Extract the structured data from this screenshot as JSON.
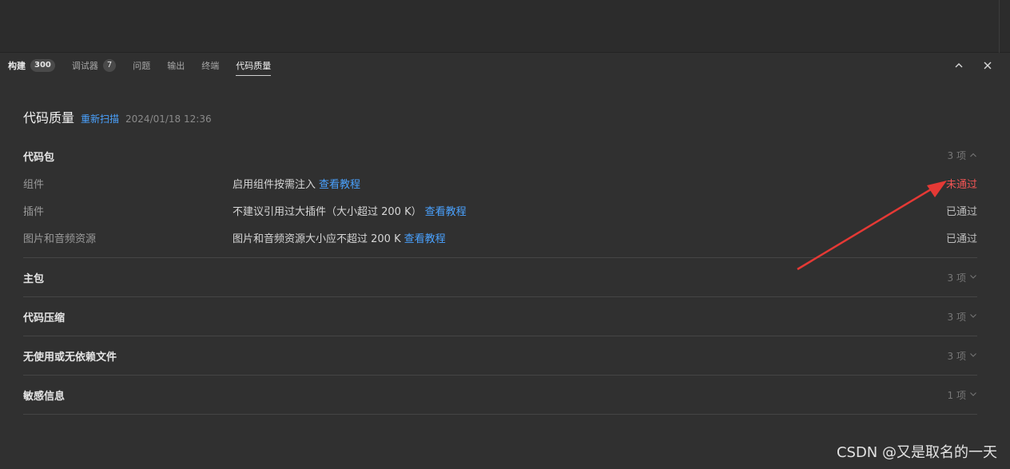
{
  "tabs": [
    {
      "label": "构建",
      "badge": "300",
      "active": false,
      "bold": true
    },
    {
      "label": "调试器",
      "badge": "7",
      "active": false,
      "bold": false
    },
    {
      "label": "问题",
      "badge": null,
      "active": false,
      "bold": false
    },
    {
      "label": "输出",
      "badge": null,
      "active": false,
      "bold": false
    },
    {
      "label": "终端",
      "badge": null,
      "active": false,
      "bold": false
    },
    {
      "label": "代码质量",
      "badge": null,
      "active": true,
      "bold": false
    }
  ],
  "heading": {
    "title": "代码质量",
    "rescan": "重新扫描",
    "time": "2024/01/18 12:36"
  },
  "sections": [
    {
      "title": "代码包",
      "count": "3 项",
      "expanded": true,
      "rows": [
        {
          "name": "组件",
          "desc": "启用组件按需注入",
          "link": "查看教程",
          "status": "未通过",
          "fail": true
        },
        {
          "name": "插件",
          "desc": "不建议引用过大插件（大小超过 200 K）",
          "link": "查看教程",
          "status": "已通过",
          "fail": false
        },
        {
          "name": "图片和音频资源",
          "desc": "图片和音频资源大小应不超过 200 K",
          "link": "查看教程",
          "status": "已通过",
          "fail": false
        }
      ]
    },
    {
      "title": "主包",
      "count": "3 项",
      "expanded": false,
      "rows": []
    },
    {
      "title": "代码压缩",
      "count": "3 项",
      "expanded": false,
      "rows": []
    },
    {
      "title": "无使用或无依赖文件",
      "count": "3 项",
      "expanded": false,
      "rows": []
    },
    {
      "title": "敏感信息",
      "count": "1 项",
      "expanded": false,
      "rows": []
    }
  ],
  "watermark": "CSDN @又是取名的一天",
  "colors": {
    "accent": "#4aa2ff",
    "fail": "#f05454",
    "arrow": "#e53935"
  },
  "icons": {
    "collapse": "chevron-up-icon",
    "close": "close-icon"
  }
}
